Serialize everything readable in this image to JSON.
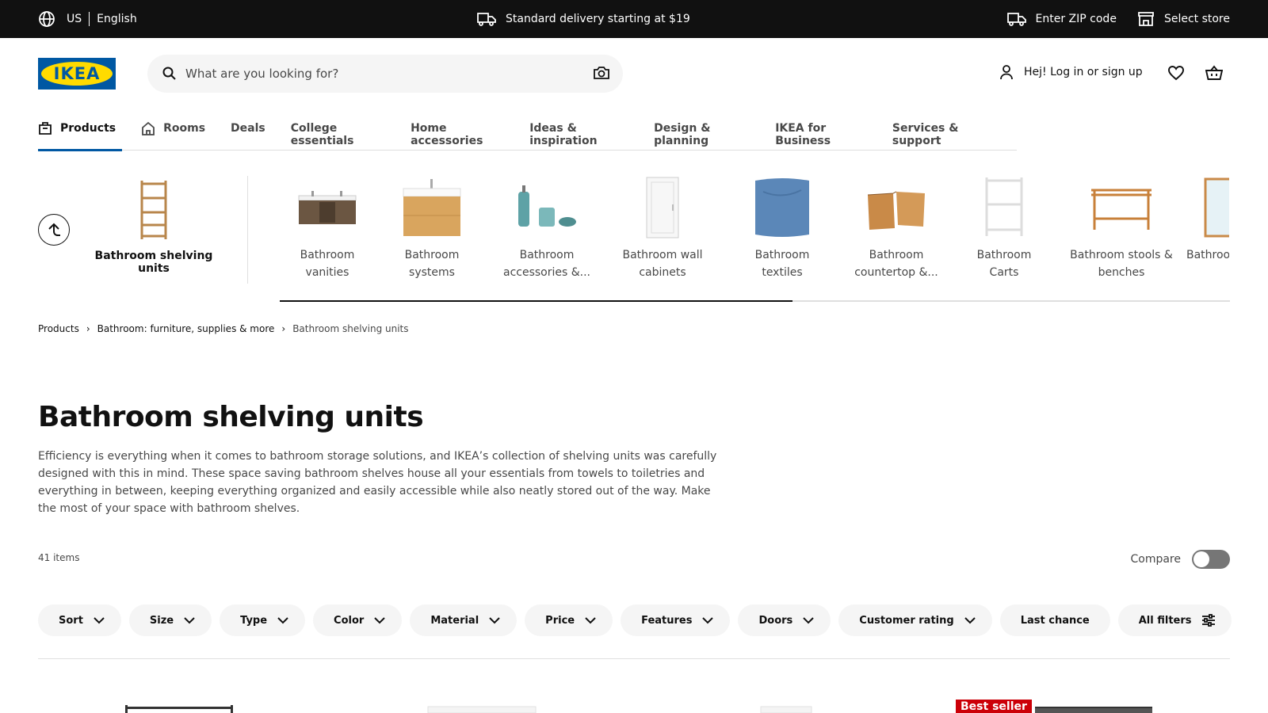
{
  "topbar": {
    "country": "US",
    "language": "English",
    "delivery": "Standard delivery starting at $19",
    "zip": "Enter ZIP code",
    "store": "Select store"
  },
  "header": {
    "logo_text": "IKEA",
    "search_placeholder": "What are you looking for?",
    "account": "Hej! Log in or sign up"
  },
  "nav": {
    "tabs": [
      {
        "label": "Products"
      },
      {
        "label": "Rooms"
      },
      {
        "label": "Deals"
      },
      {
        "label": "College essentials"
      },
      {
        "label": "Home accessories"
      },
      {
        "label": "Ideas & inspiration"
      },
      {
        "label": "Design & planning"
      },
      {
        "label": "IKEA for Business"
      },
      {
        "label": "Services & support"
      }
    ]
  },
  "categories": {
    "current": "Bathroom shelving units",
    "items": [
      {
        "label": "Bathroom vanities"
      },
      {
        "label": "Bathroom systems"
      },
      {
        "label": "Bathroom accessories &..."
      },
      {
        "label": "Bathroom wall cabinets"
      },
      {
        "label": "Bathroom textiles"
      },
      {
        "label": "Bathroom countertop &..."
      },
      {
        "label": "Bathroom Carts"
      },
      {
        "label": "Bathroom stools & benches"
      },
      {
        "label": "Bathroo"
      }
    ],
    "scroll_progress": 0.54
  },
  "breadcrumb": [
    "Products",
    "Bathroom: furniture, supplies & more",
    "Bathroom shelving units"
  ],
  "page": {
    "title": "Bathroom shelving units",
    "description": "Efficiency is everything when it comes to bathroom storage solutions, and IKEA’s collection of shelving units was carefully designed with this in mind. These space saving bathroom shelves house all your essentials from towels to toiletries and everything in between, keeping everything organized and easily accessible while also neatly stored out of the way. Make the most of your space with bathroom shelves.",
    "item_count": "41 items",
    "compare_label": "Compare",
    "compare_on": false
  },
  "filters": [
    {
      "label": "Sort",
      "dropdown": true
    },
    {
      "label": "Size",
      "dropdown": true
    },
    {
      "label": "Type",
      "dropdown": true
    },
    {
      "label": "Color",
      "dropdown": true
    },
    {
      "label": "Material",
      "dropdown": true
    },
    {
      "label": "Price",
      "dropdown": true
    },
    {
      "label": "Features",
      "dropdown": true
    },
    {
      "label": "Doors",
      "dropdown": true
    },
    {
      "label": "Customer rating",
      "dropdown": true
    },
    {
      "label": "Last chance",
      "dropdown": false
    },
    {
      "label": "All filters",
      "dropdown": false
    }
  ],
  "products": {
    "badge": "Best seller"
  },
  "colors": {
    "brand_blue": "#0058a3",
    "brand_yellow": "#ffdb00",
    "topbar_bg": "#111111",
    "badge_red": "#cc0008"
  }
}
